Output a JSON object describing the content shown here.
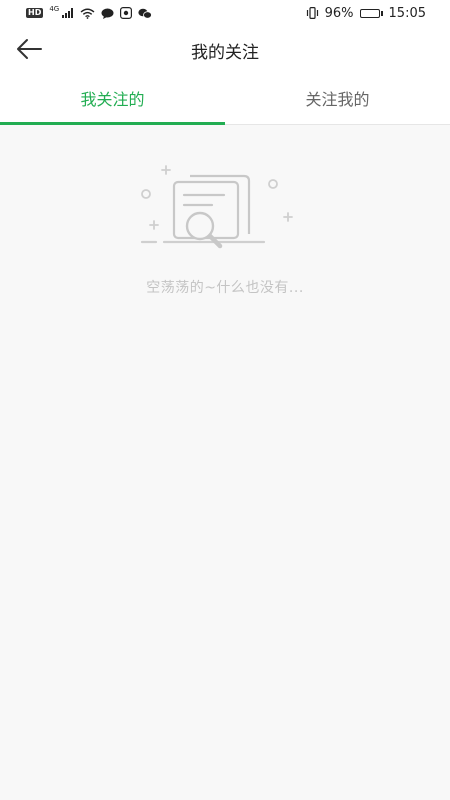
{
  "status_bar": {
    "hd": "HD",
    "network": "4G",
    "battery": "96%",
    "battery_level": 0.96,
    "time": "15:05"
  },
  "header": {
    "title": "我的关注"
  },
  "tabs": [
    {
      "label": "我关注的",
      "active": true
    },
    {
      "label": "关注我的",
      "active": false
    }
  ],
  "empty_state": {
    "message": "空荡荡的~什么也没有..."
  },
  "colors": {
    "accent": "#22ad52",
    "background": "#f8f8f8",
    "muted_text": "#c4c4c4"
  }
}
